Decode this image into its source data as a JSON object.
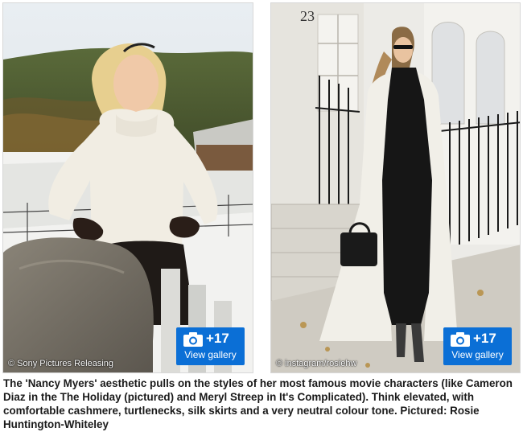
{
  "photos": [
    {
      "credit": "© Sony Pictures Releasing",
      "gallery": {
        "count": "+17",
        "label": "View gallery",
        "icon": "camera-icon"
      }
    },
    {
      "credit": "© instagram/rosiehw",
      "door_number": "23",
      "gallery": {
        "count": "+17",
        "label": "View gallery",
        "icon": "camera-icon"
      }
    }
  ],
  "caption": "The 'Nancy Myers' aesthetic pulls on the styles of her most famous movie characters (like Cameron Diaz in the The Holiday (pictured) and Meryl Streep in It's Complicated). Think elevated, with comfortable cashmere, turtlenecks, silk skirts and a very neutral colour tone. Pictured: Rosie Huntington-Whiteley",
  "colors": {
    "badge": "#0b6fd6",
    "caption_text": "#1a1a1a"
  }
}
